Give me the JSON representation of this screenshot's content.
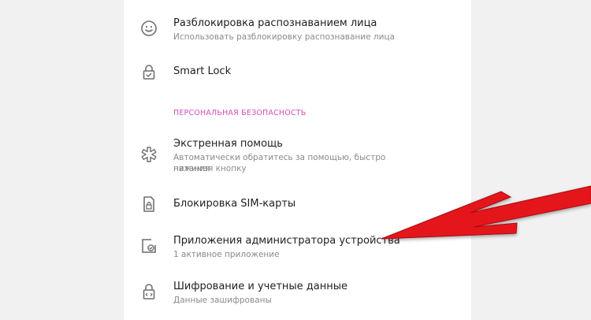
{
  "settings": {
    "face_unlock": {
      "title": "Разблокировка распознаванием лица",
      "subtitle": "Использовать разблокировку распознавание лица",
      "icon": "smiley-face-icon"
    },
    "smart_lock": {
      "title": "Smart Lock",
      "icon": "smart-lock-icon"
    },
    "section_header": "ПЕРСОНАЛЬНАЯ БЕЗОПАСНОСТЬ",
    "emergency": {
      "title": "Экстренная помощь",
      "subtitle_line1": "Автоматически обратитесь за помощью, быстро нажимая кнопку",
      "subtitle_line2": "питания",
      "icon": "emergency-asterisk-icon"
    },
    "sim_lock": {
      "title": "Блокировка SIM-карты",
      "icon": "sim-lock-icon"
    },
    "device_admin": {
      "title": "Приложения администратора устройства",
      "subtitle": "1 активное приложение",
      "icon": "device-admin-icon"
    },
    "encryption": {
      "title": "Шифрование и учетные данные",
      "subtitle": "Данные зашифрованы",
      "icon": "encryption-lock-icon"
    }
  },
  "colors": {
    "section_accent": "#d34ec0",
    "arrow": "#e4141b",
    "icon": "#6f6f6f"
  }
}
